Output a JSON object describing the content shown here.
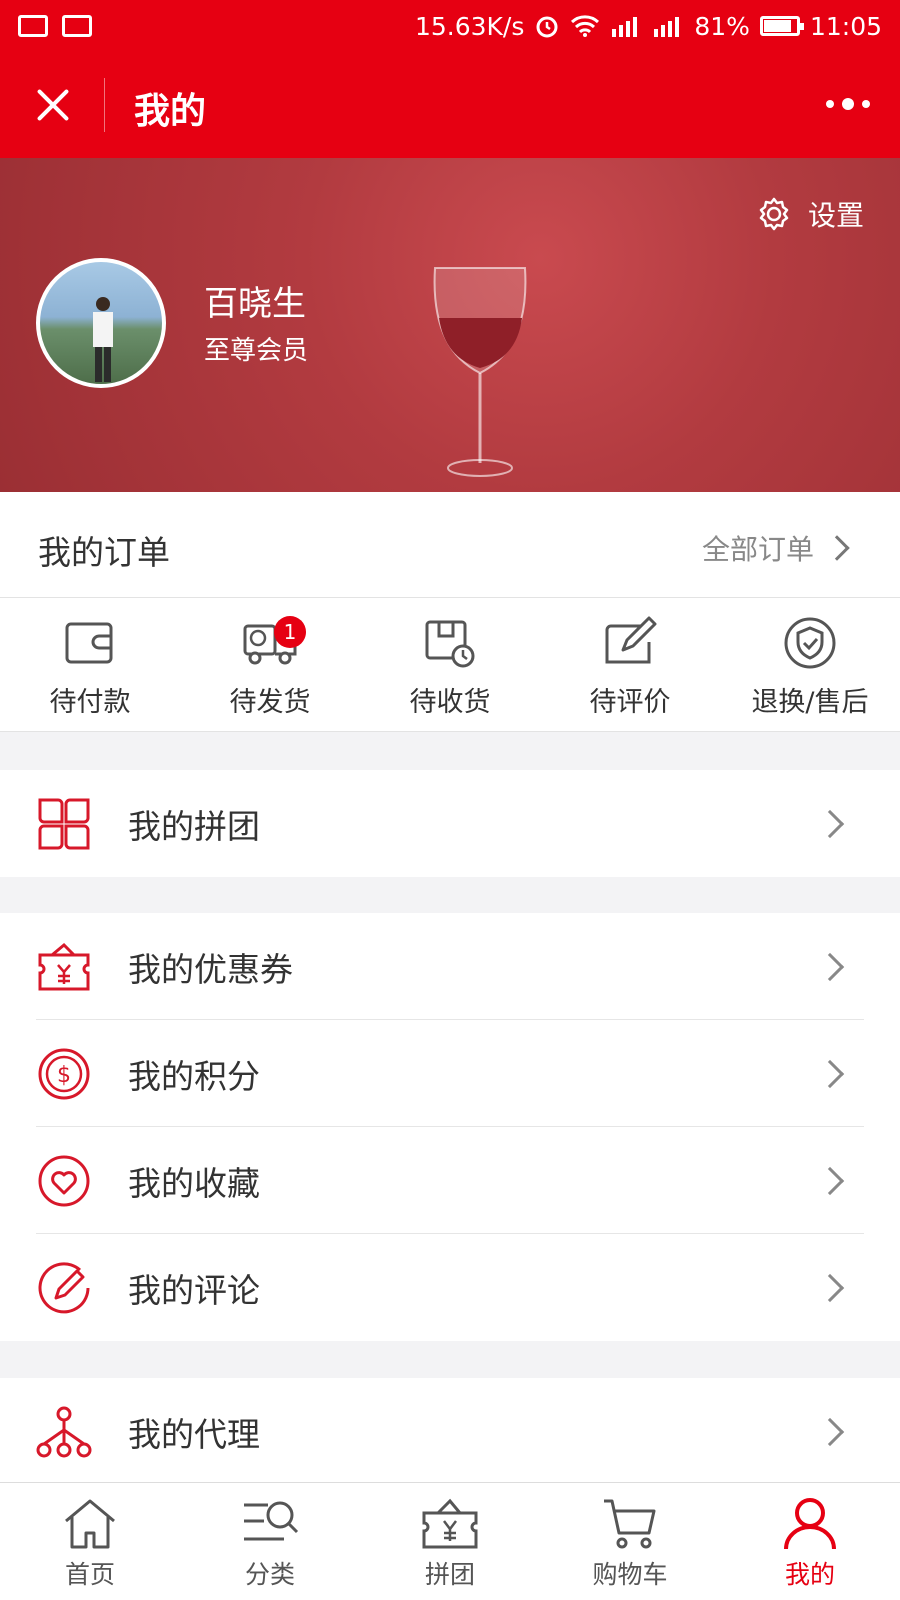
{
  "status_bar": {
    "speed": "15.63K/s",
    "battery": "81%",
    "time": "11:05"
  },
  "nav": {
    "title": "我的"
  },
  "profile": {
    "settings_label": "设置",
    "name": "百晓生",
    "level": "至尊会员"
  },
  "orders": {
    "title": "我的订单",
    "all_label": "全部订单",
    "tabs": [
      {
        "label": "待付款",
        "icon": "wallet-icon"
      },
      {
        "label": "待发货",
        "icon": "delivery-truck-icon",
        "badge": "1"
      },
      {
        "label": "待收货",
        "icon": "package-clock-icon"
      },
      {
        "label": "待评价",
        "icon": "edit-review-icon"
      },
      {
        "label": "退换/售后",
        "icon": "shield-check-icon"
      }
    ]
  },
  "menu": {
    "group_buy": "我的拼团",
    "coupons": "我的优惠券",
    "points": "我的积分",
    "favorites": "我的收藏",
    "comments": "我的评论",
    "agent": "我的代理"
  },
  "tabbar": {
    "items": [
      {
        "label": "首页",
        "icon": "home-icon"
      },
      {
        "label": "分类",
        "icon": "category-search-icon"
      },
      {
        "label": "拼团",
        "icon": "group-buy-icon"
      },
      {
        "label": "购物车",
        "icon": "cart-icon"
      },
      {
        "label": "我的",
        "icon": "profile-icon",
        "active": true
      }
    ]
  },
  "colors": {
    "brand_red": "#e60012",
    "banner_red": "#b23b40",
    "icon_red": "#d7182a"
  }
}
